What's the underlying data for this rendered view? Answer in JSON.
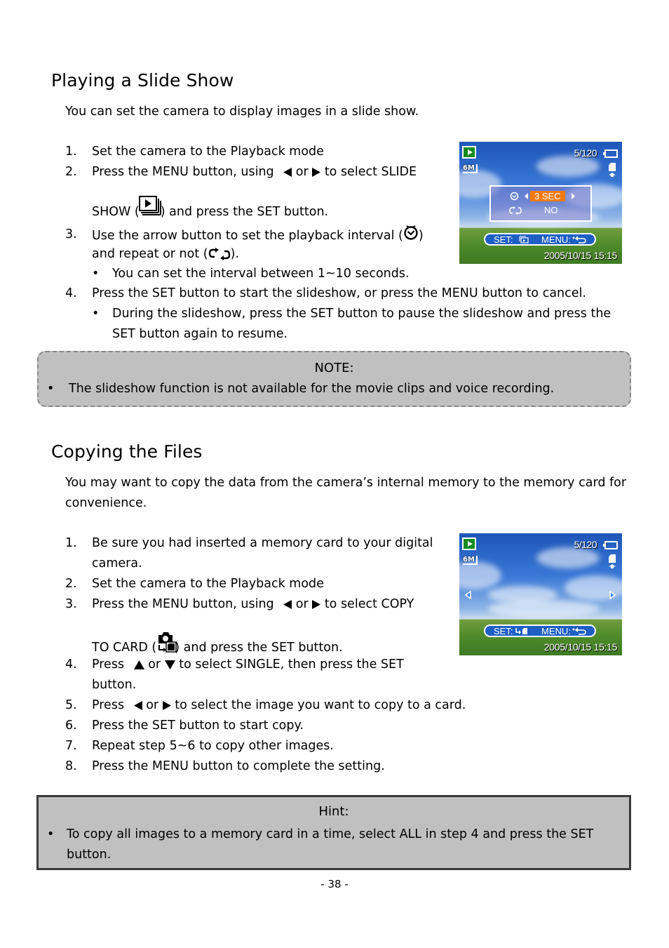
{
  "section1": {
    "title": "Playing a Slide Show",
    "intro": "You can set the camera to display images in a slide show.",
    "steps": [
      {
        "num": "1.",
        "text": "Set the camera to the Playback mode"
      },
      {
        "num": "2.",
        "pre": "Press the ",
        "kw1": "MENU",
        "mid1": " button, using ",
        "or": " or ",
        "mid2": " to select ",
        "kw2": "SLIDE",
        "line2_kw": "SHOW",
        "line2_open": " (",
        "line2_close": ") and press the ",
        "line2_kw2": "SET",
        "line2_end": " button."
      },
      {
        "num": "3.",
        "line1": "Use the arrow button to set the playback interval (",
        "line1_end": ")",
        "line2": "and repeat or not (",
        "line2_end": ").",
        "bullet": "You can set the interval between 1~10 seconds."
      },
      {
        "num": "4.",
        "pre": "Press the ",
        "kw1": "SET",
        "mid": " button to start the slideshow, or press the ",
        "kw2": "MENU",
        "end": " button to cancel.",
        "bullet_l1_pre": "During the slideshow, press the ",
        "bullet_l1_kw": "SET",
        "bullet_l1_end": " button to pause the slideshow and press the",
        "bullet_l2_kw": "SET",
        "bullet_l2_end": " button again to resume."
      }
    ],
    "screen": {
      "counter": "5/120",
      "size_badge": "6M",
      "interval_value": "3 SEC",
      "repeat_value": "NO",
      "set_label": "SET:",
      "menu_label": "MENU:",
      "datetime": "2005/10/15  15:15",
      "accent": "#f07a10"
    }
  },
  "note": {
    "title": "NOTE:",
    "bullet": "The slideshow function is not available for the movie clips and voice recording."
  },
  "section2": {
    "title": "Copying the Files",
    "intro_l1": "You may want to copy the data from the camera’s internal memory to the memory card for",
    "intro_l2": "convenience.",
    "steps": [
      {
        "num": "1.",
        "l1": "Be sure you had inserted a memory card to your digital",
        "l2": "camera."
      },
      {
        "num": "2.",
        "text": "Set the camera to the Playback mode"
      },
      {
        "num": "3.",
        "pre": "Press the ",
        "kw1": "MENU",
        "mid1": " button, using ",
        "or": " or ",
        "mid2": " to select ",
        "kw2": "COPY",
        "line2_kw": "TO CARD",
        "line2_open": " (",
        "line2_close": ") and press the ",
        "line2_kw2": "SET",
        "line2_end": " button."
      },
      {
        "num": "4.",
        "pre": "Press ",
        "or": " or ",
        "mid": " to select ",
        "kw1": "SINGLE",
        "mid2": ", then press the ",
        "kw2": "SET",
        "l2": "button."
      },
      {
        "num": "5.",
        "pre": "Press ",
        "or": " or ",
        "end": " to select the image you want to copy to a card."
      },
      {
        "num": "6.",
        "pre": "Press the ",
        "kw": "SET",
        "end": " button to start copy."
      },
      {
        "num": "7.",
        "text": "Repeat step 5~6 to copy other images."
      },
      {
        "num": "8.",
        "pre": "Press the ",
        "kw": "MENU",
        "end": " button to complete the setting."
      }
    ],
    "screen": {
      "counter": "5/120",
      "size_badge": "6M",
      "set_label": "SET:",
      "menu_label": "MENU:",
      "datetime": "2005/10/15  15:15"
    }
  },
  "hint": {
    "title": "Hint:",
    "l1_pre": "To copy all images to a memory card in a time, select ",
    "l1_kw": "ALL",
    "l1_mid": " in step 4 and press the ",
    "l1_kw2": "SET",
    "l2": "button."
  },
  "footer": {
    "page": "- 38 -"
  }
}
